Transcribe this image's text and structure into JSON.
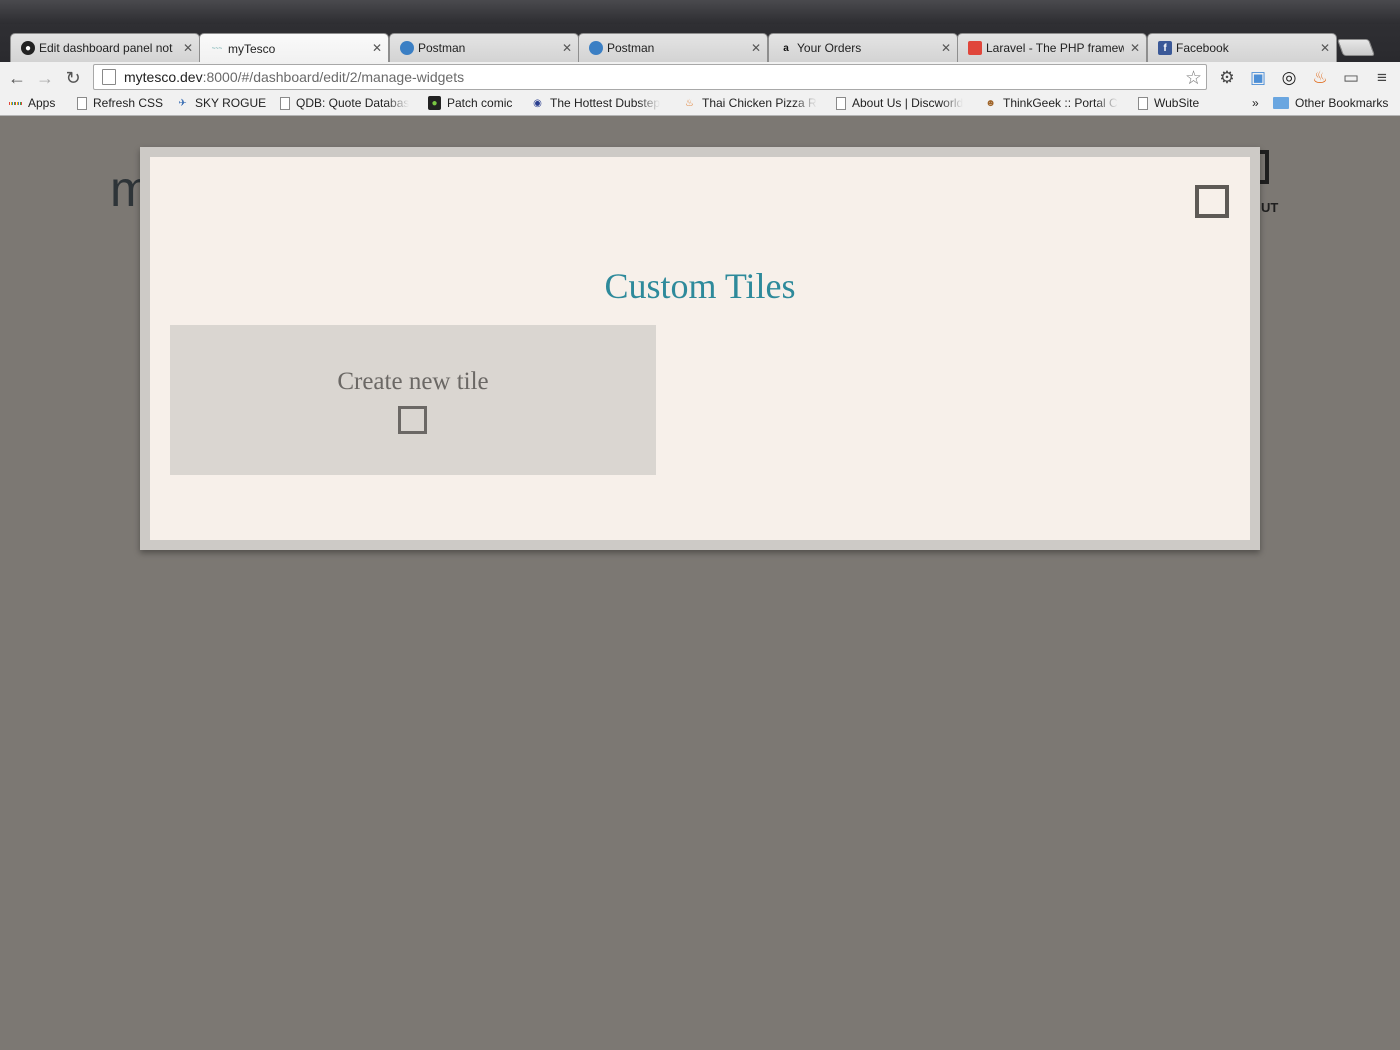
{
  "browser": {
    "tabs": [
      {
        "title": "Edit dashboard panel not",
        "icon": "github-icon",
        "active": false
      },
      {
        "title": "myTesco",
        "icon": "tesco-icon",
        "active": true
      },
      {
        "title": "Postman",
        "icon": "globe-icon",
        "active": false
      },
      {
        "title": "Postman",
        "icon": "globe-icon",
        "active": false
      },
      {
        "title": "Your Orders",
        "icon": "amazon-icon",
        "active": false
      },
      {
        "title": "Laravel - The PHP framew",
        "icon": "laravel-icon",
        "active": false
      },
      {
        "title": "Facebook",
        "icon": "facebook-icon",
        "active": false
      }
    ],
    "url": {
      "host": "mytesco.dev",
      "rest": ":8000/#/dashboard/edit/2/manage-widgets"
    },
    "bookmarks": [
      {
        "label": "Apps",
        "icon": "apps-grid-icon"
      },
      {
        "label": "Refresh CSS",
        "icon": "page-icon"
      },
      {
        "label": "SKY ROGUE",
        "icon": "jet-icon"
      },
      {
        "label": "QDB: Quote Databas",
        "icon": "page-icon"
      },
      {
        "label": "Patch comic",
        "icon": "patch-icon"
      },
      {
        "label": "The Hottest Dubstep",
        "icon": "dubstep-icon"
      },
      {
        "label": "Thai Chicken Pizza R",
        "icon": "recipe-icon"
      },
      {
        "label": "About Us | Discworld",
        "icon": "page-icon"
      },
      {
        "label": "ThinkGeek :: Portal C",
        "icon": "thinkgeek-icon"
      },
      {
        "label": "WubSite",
        "icon": "page-icon"
      }
    ],
    "overflow_label": "»",
    "other_bookmarks": "Other Bookmarks"
  },
  "background_page": {
    "logo_fragment": "m",
    "nav_fragment": "UT"
  },
  "modal": {
    "title": "Custom Tiles",
    "tiles": [
      {
        "label": "Create new tile",
        "icon": "add-square-icon"
      }
    ]
  },
  "colors": {
    "overlay": "#7c7873",
    "modal_bg": "#f7f0ea",
    "title": "#2e8a9b",
    "tile_bg": "#dad6d1"
  }
}
